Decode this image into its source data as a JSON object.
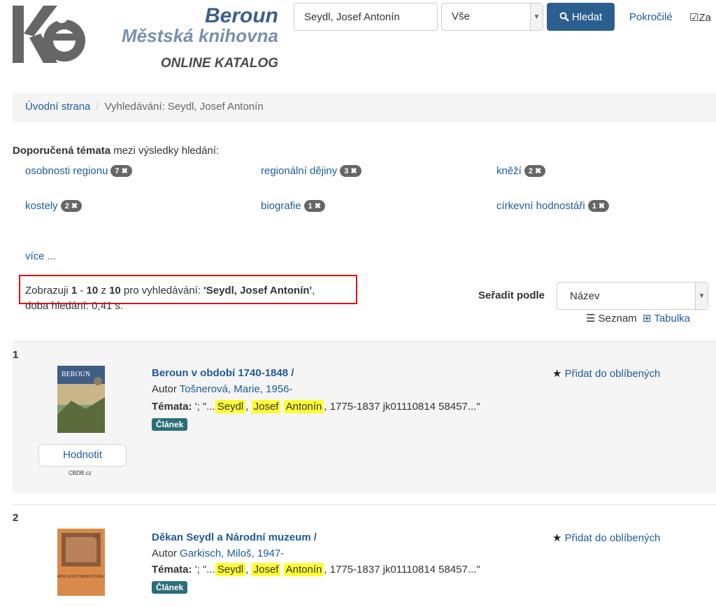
{
  "header": {
    "brand_city": "Beroun",
    "brand_library": "Městská knihovna",
    "brand_catalog": "ONLINE KATALOG",
    "search_value": "Seydl, Josef Antonín",
    "search_scope": "Vše",
    "search_button": "Hledat",
    "advanced": "Pokročilé",
    "save_label": "Za",
    "save_check": "☑"
  },
  "breadcrumb": {
    "home": "Úvodní strana",
    "separator": "/",
    "current": "Vyhledávání: Seydl, Josef Antonín"
  },
  "topics": {
    "title_bold": "Doporučená témata",
    "title_rest": " mezi výsledky hledání:",
    "items": [
      {
        "label": "osobnosti regionu",
        "count": "7 ✖"
      },
      {
        "label": "regionální dějiny",
        "count": "3 ✖"
      },
      {
        "label": "kněží",
        "count": "2 ✖"
      },
      {
        "label": "kostely",
        "count": "2 ✖"
      },
      {
        "label": "biografie",
        "count": "1 ✖"
      },
      {
        "label": "církevní hodnostáři",
        "count": "1 ✖"
      }
    ],
    "more": "více ..."
  },
  "summary": {
    "prefix": "Zobrazuji ",
    "from": "1",
    "dash": " - ",
    "to": "10",
    "of_word": " z ",
    "total": "10",
    "for_word": " pro vyhledávání: ",
    "query": "'Seydl, Josef Antonín'",
    "comma": ",",
    "time": "doba hledání: 0,41 s."
  },
  "sort": {
    "label": "Seřadit podle",
    "value": "Název",
    "view_list": "Seznam",
    "view_table": "Tabulka"
  },
  "results": [
    {
      "number": "1",
      "title": "Beroun v období 1740-1848 /",
      "author_prefix": "Autor ",
      "author": "Tošnerová, Marie, 1956-",
      "topics_label": "Témata:",
      "topics_pre": " '; \"...",
      "hl1": "Seydl",
      "hl2": "Josef",
      "hl3": "Antonín",
      "topics_post": ", 1775-1837 jk01110814 58457...\"",
      "type": "Článek",
      "favorite": "Přidat do oblíbených",
      "rate": "Hodnotit",
      "cbdb": "CBDB.cz",
      "cover_text": "BEROUN"
    },
    {
      "number": "2",
      "title": "Děkan Seydl a Národní muzeum /",
      "author_prefix": "Autor ",
      "author": "Garkisch, Miloš, 1947-",
      "topics_label": "Témata:",
      "topics_pre": " '; \"...",
      "hl1": "Seydl",
      "hl2": "Josef",
      "hl3": "Antonín",
      "topics_post": ", 1775-1837 jk01110814 58457...\"",
      "type": "Článek",
      "favorite": "Přidat do oblíbených",
      "cover_text": "MINULOSTÍ BEROUNSKA",
      "cover_num": "11"
    }
  ],
  "colors": {
    "accent": "#2b5f8f",
    "link": "#1f5b99",
    "highlight": "#ffff33",
    "annotation": "#e01010"
  }
}
